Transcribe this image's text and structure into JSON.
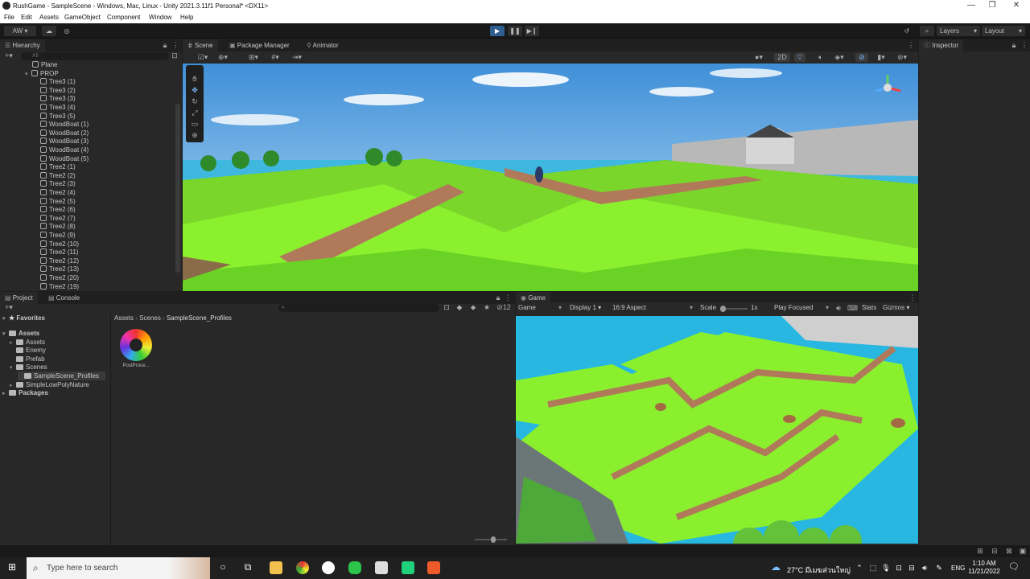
{
  "window": {
    "title": "RushGame - SampleScene - Windows, Mac, Linux - Unity 2021.3.11f1 Personal* <DX11>",
    "min": "—",
    "max": "❐",
    "close": "✕"
  },
  "menu": [
    "File",
    "Edit",
    "Assets",
    "GameObject",
    "Component",
    "Window",
    "Help"
  ],
  "toolbar": {
    "account": "AW",
    "layers": "Layers",
    "layout": "Layout"
  },
  "hierarchy": {
    "tab": "Hierarchy",
    "search_placeholder": "All",
    "items": [
      "Plane",
      "PROP",
      "Tree3 (1)",
      "Tree3 (2)",
      "Tree3 (3)",
      "Tree3 (4)",
      "Tree3 (5)",
      "WoodBoat (1)",
      "WoodBoat (2)",
      "WoodBoat (3)",
      "WoodBoat (4)",
      "WoodBoat (5)",
      "Tree2 (1)",
      "Tree2 (2)",
      "Tree2 (3)",
      "Tree2 (4)",
      "Tree2 (5)",
      "Tree2 (6)",
      "Tree2 (7)",
      "Tree2 (8)",
      "Tree2 (9)",
      "Tree2 (10)",
      "Tree2 (11)",
      "Tree2 (12)",
      "Tree2 (13)",
      "Tree2 (20)",
      "Tree2 (19)"
    ]
  },
  "scene": {
    "tabs": [
      "Scene",
      "Package Manager",
      "Animator"
    ],
    "mode_2d": "2D"
  },
  "inspector": {
    "tab": "Inspector"
  },
  "project": {
    "tabs": [
      "Project",
      "Console"
    ],
    "hidden_count": "12",
    "breadcrumb": [
      "Assets",
      "Scenes",
      "SampleScene_Profiles"
    ],
    "favorites": "Favorites",
    "tree": [
      {
        "label": "Assets",
        "bold": true
      },
      {
        "label": "Assets",
        "bold": false
      },
      {
        "label": "Enemy",
        "bold": false
      },
      {
        "label": "Prefab",
        "bold": false
      },
      {
        "label": "Scenes",
        "bold": false
      },
      {
        "label": "SampleScene_Profiles",
        "bold": false
      },
      {
        "label": "SimpleLowPolyNature",
        "bold": false
      },
      {
        "label": "Packages",
        "bold": true
      }
    ],
    "asset_label": "PostProce..."
  },
  "game": {
    "tab": "Game",
    "mode": "Game",
    "display": "Display 1",
    "aspect": "16:9 Aspect",
    "scale_label": "Scale",
    "scale_value": "1x",
    "play_focused": "Play Focused",
    "stats": "Stats",
    "gizmos": "Gizmos"
  },
  "taskbar": {
    "search_placeholder": "Type here to search",
    "weather": "27°C มีเมฆส่วนใหญ่",
    "lang": "ENG",
    "time": "1:10 AM",
    "date": "11/21/2022"
  }
}
